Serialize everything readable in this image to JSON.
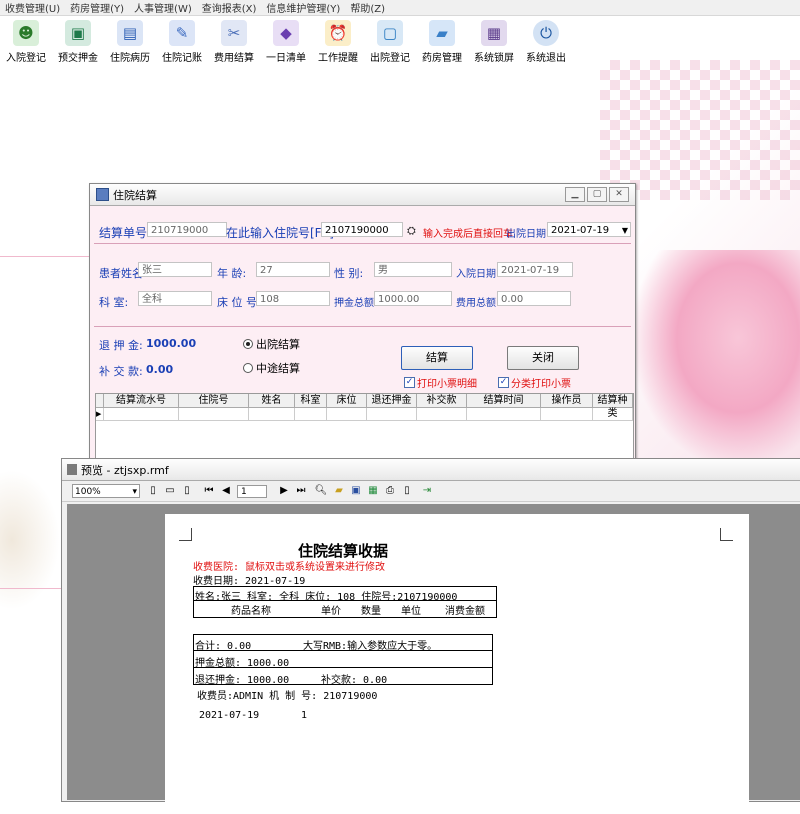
{
  "menu": [
    "收费管理(U)",
    "药房管理(Y)",
    "人事管理(W)",
    "查询报表(X)",
    "信息维护管理(Y)",
    "帮助(Z)"
  ],
  "toolbar": [
    {
      "label": "入院登记",
      "icon": "person-register-icon",
      "color": "#3a9a3a"
    },
    {
      "label": "预交押金",
      "icon": "deposit-icon",
      "color": "#2e8a5a"
    },
    {
      "label": "住院病历",
      "icon": "medical-record-icon",
      "color": "#3b6fc4"
    },
    {
      "label": "住院记账",
      "icon": "ledger-icon",
      "color": "#4b7ad0"
    },
    {
      "label": "费用结算",
      "icon": "settlement-icon",
      "color": "#5a7ec8"
    },
    {
      "label": "一日清单",
      "icon": "daily-list-icon",
      "color": "#7a4fc0"
    },
    {
      "label": "工作提醒",
      "icon": "alarm-clock-icon",
      "color": "#d8a020"
    },
    {
      "label": "出院登记",
      "icon": "discharge-icon",
      "color": "#3a8ad0"
    },
    {
      "label": "药房管理",
      "icon": "pharmacy-folder-icon",
      "color": "#4a90d8"
    },
    {
      "label": "系统锁屏",
      "icon": "lock-screen-icon",
      "color": "#6a4a9a"
    },
    {
      "label": "系统退出",
      "icon": "power-exit-icon",
      "color": "#2060b0"
    }
  ],
  "settle_window": {
    "title": "住院结算",
    "settle_no_label": "结算单号:",
    "settle_no_value": "210719000",
    "inpatient_prompt": "在此输入住院号[F2]:",
    "inpatient_no_value": "2107190000",
    "hint": "输入完成后直接回车",
    "discharge_date_label": "出院日期:",
    "discharge_date_value": "2021-07-19",
    "patient_name_label": "患者姓名:",
    "patient_name_value": "张三",
    "age_label": "年    龄:",
    "age_value": "27",
    "sex_label": "性    别:",
    "sex_value": "男",
    "admit_date_label": "入院日期:",
    "admit_date_value": "2021-07-19",
    "dept_label": "科    室:",
    "dept_value": "全科",
    "bed_label": "床 位 号:",
    "bed_value": "108",
    "deposit_total_label": "押金总额:",
    "deposit_total_value": "1000.00",
    "fee_total_label": "费用总额:",
    "fee_total_value": "0.00",
    "refund_label": "退 押 金:",
    "refund_value": "1000.00",
    "supplement_label": "补 交 款:",
    "supplement_value": "0.00",
    "radio_discharge": "出院结算",
    "radio_midway": "中途结算",
    "settle_button": "结算",
    "close_button": "关闭",
    "print_detail": "打印小票明细",
    "print_category": "分类打印小票",
    "grid_headers": [
      "结算流水号",
      "住院号",
      "姓名",
      "科室",
      "床位",
      "退还押金",
      "补交款",
      "结算时间",
      "操作员",
      "结算种类"
    ]
  },
  "preview_window": {
    "title": "预览 - ztjsxp.rmf",
    "zoom": "100%",
    "page": "1"
  },
  "receipt": {
    "title": "住院结算收据",
    "hospital_line": "收费医院: 鼠标双击或系统设置来进行修改",
    "date_line": "收费日期: 2021-07-19",
    "info_line": "姓名:张三      科室: 全科      床位: 108   住院号:2107190000",
    "col_name": "药品名称",
    "col_price": "单价",
    "col_qty": "数量",
    "col_unit": "单位",
    "col_amount": "消费金额",
    "total_line": "合计: 0.00",
    "rmb_line": "大写RMB:输入参数应大于零。",
    "deposit_line": "押金总额: 1000.00",
    "refund_line": "退还押金: 1000.00",
    "supp_line": "补交款: 0.00",
    "cashier_line": "收费员:ADMIN    机 制 号: 210719000",
    "footer_date": "2021-07-19",
    "footer_page": "1"
  }
}
